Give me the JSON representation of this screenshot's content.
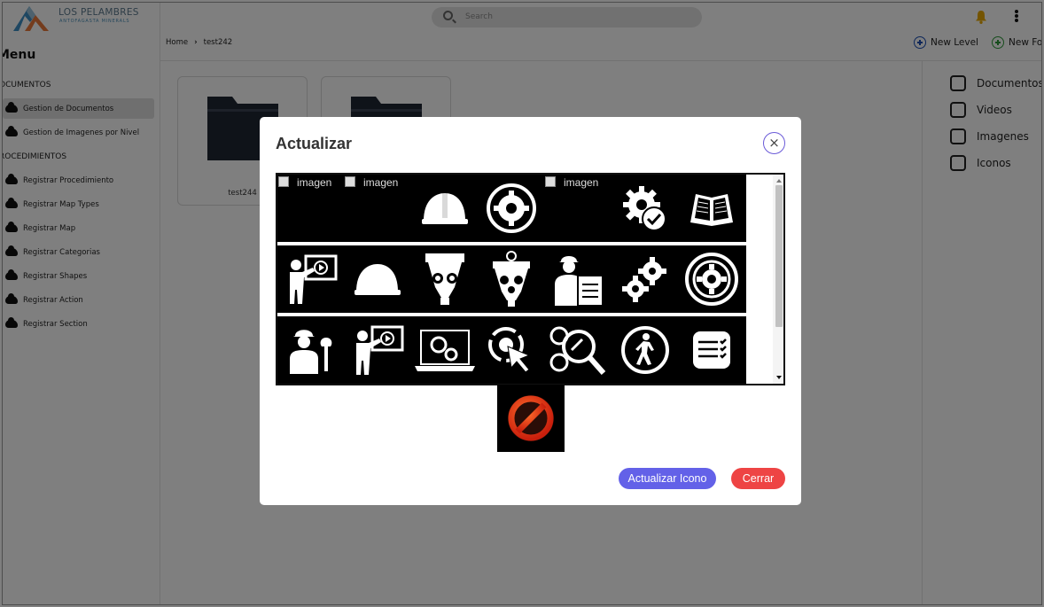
{
  "brand": {
    "name": "LOS PELAMBRES",
    "tagline": "ANTOFAGASTA MINERALS"
  },
  "sidebar": {
    "title": "Menu",
    "sections": [
      {
        "label": "DOCUMENTOS",
        "items": [
          "Gestion de Documentos",
          "Gestion de Imagenes por Nivel"
        ]
      },
      {
        "label": "PROCEDIMIENTOS",
        "items": [
          "Registrar Procedimiento",
          "Registrar Map Types",
          "Registrar Map",
          "Registrar Categorias",
          "Registrar Shapes",
          "Registrar Action",
          "Registrar Section"
        ]
      }
    ],
    "active_item": "Gestion de Documentos",
    "visible_labels": [
      "OCUMENTOS",
      "ROCEDIMIENTOS"
    ]
  },
  "header": {
    "search_placeholder": "Search",
    "breadcrumb": [
      "Home",
      "test242"
    ],
    "actions": [
      "New Level",
      "New Fol"
    ]
  },
  "content": {
    "folders": [
      {
        "label": "test244"
      },
      {
        "label": ""
      }
    ]
  },
  "filters": [
    "Documentos",
    "Videos",
    "Imagenes",
    "Iconos"
  ],
  "modal": {
    "title": "Actualizar",
    "close_symbol": "×",
    "broken_image_alt": "imagen",
    "gallery_rows": [
      [
        "broken-image",
        "broken-image",
        "hard-hat-icon",
        "gear-circle-icon",
        "broken-image",
        "gear-check-icon",
        "open-book-icon"
      ],
      [
        "presenter-video-icon",
        "hard-hat-icon",
        "crusher-gears-icon",
        "mill-gears-icon",
        "worker-clipboard-icon",
        "gears-icon",
        "gear-cycle-icon"
      ],
      [
        "worker-wrench-icon",
        "presenter-video-icon",
        "laptop-gears-icon",
        "target-click-icon",
        "gears-search-icon",
        "pedestrian-circle-icon",
        "checklist-icon"
      ]
    ],
    "current_icon": "prohibited-icon",
    "buttons": {
      "update": "Actualizar Icono",
      "close": "Cerrar"
    }
  },
  "colors": {
    "primary": "#6361e8",
    "danger": "#ee4444",
    "bell": "#e8a800",
    "overlay": "rgba(0,0,0,0.5)"
  }
}
